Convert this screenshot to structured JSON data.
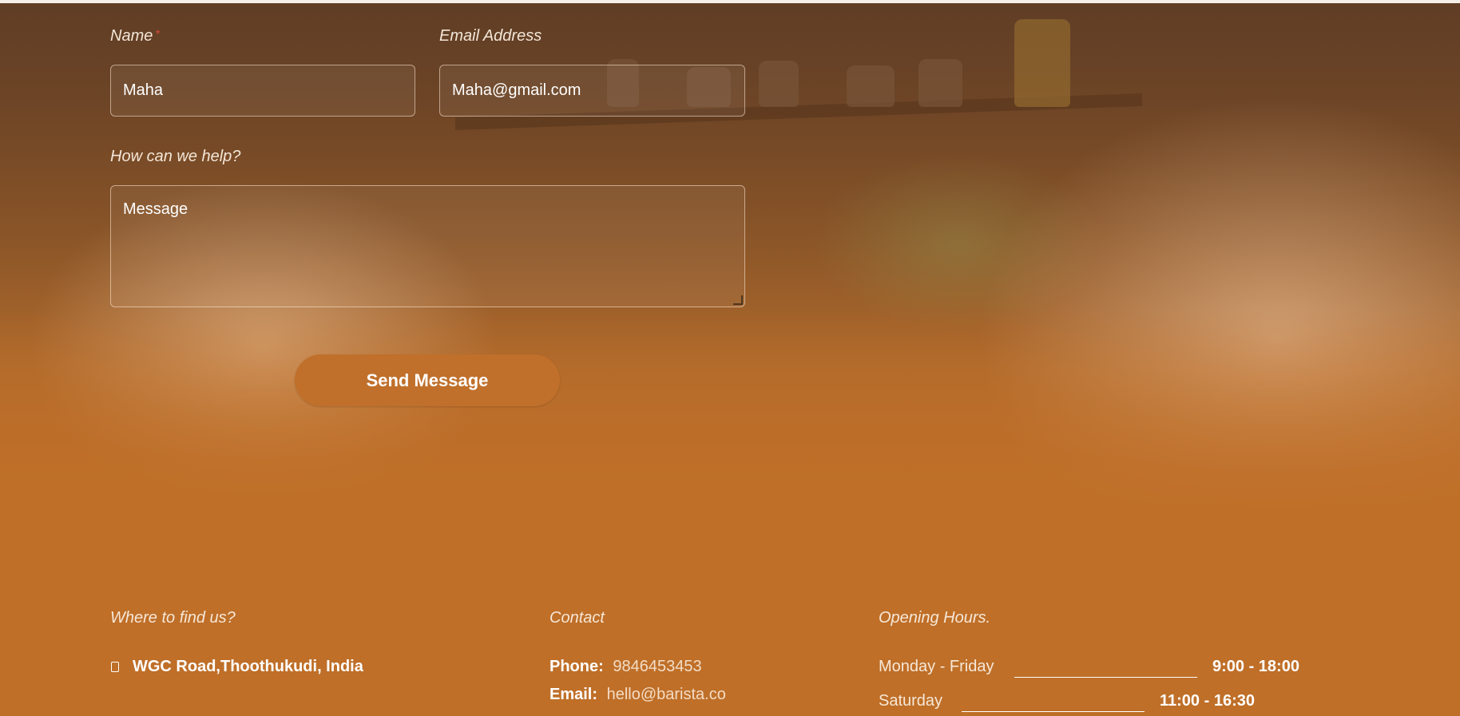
{
  "form": {
    "name_label": "Name",
    "name_required": "*",
    "name_value": "Maha",
    "email_label": "Email Address",
    "email_value": "Maha@gmail.com",
    "help_label": "How can we help?",
    "message_placeholder": "Message",
    "submit_label": "Send Message"
  },
  "footer": {
    "find_title": "Where to find us?",
    "address": "WGC Road,Thoothukudi, India",
    "contact_title": "Contact",
    "phone_label": "Phone:",
    "phone_value": "9846453453",
    "email_label": "Email:",
    "email_value": "hello@barista.co",
    "hours_title": "Opening Hours.",
    "hours": [
      {
        "days": "Monday - Friday",
        "time": "9:00 - 18:00"
      },
      {
        "days": "Saturday",
        "time": "11:00 - 16:30"
      }
    ]
  },
  "colors": {
    "accent": "#c0702b",
    "background": "#bf6f28"
  },
  "icons": {
    "address": "map-pin-icon"
  }
}
